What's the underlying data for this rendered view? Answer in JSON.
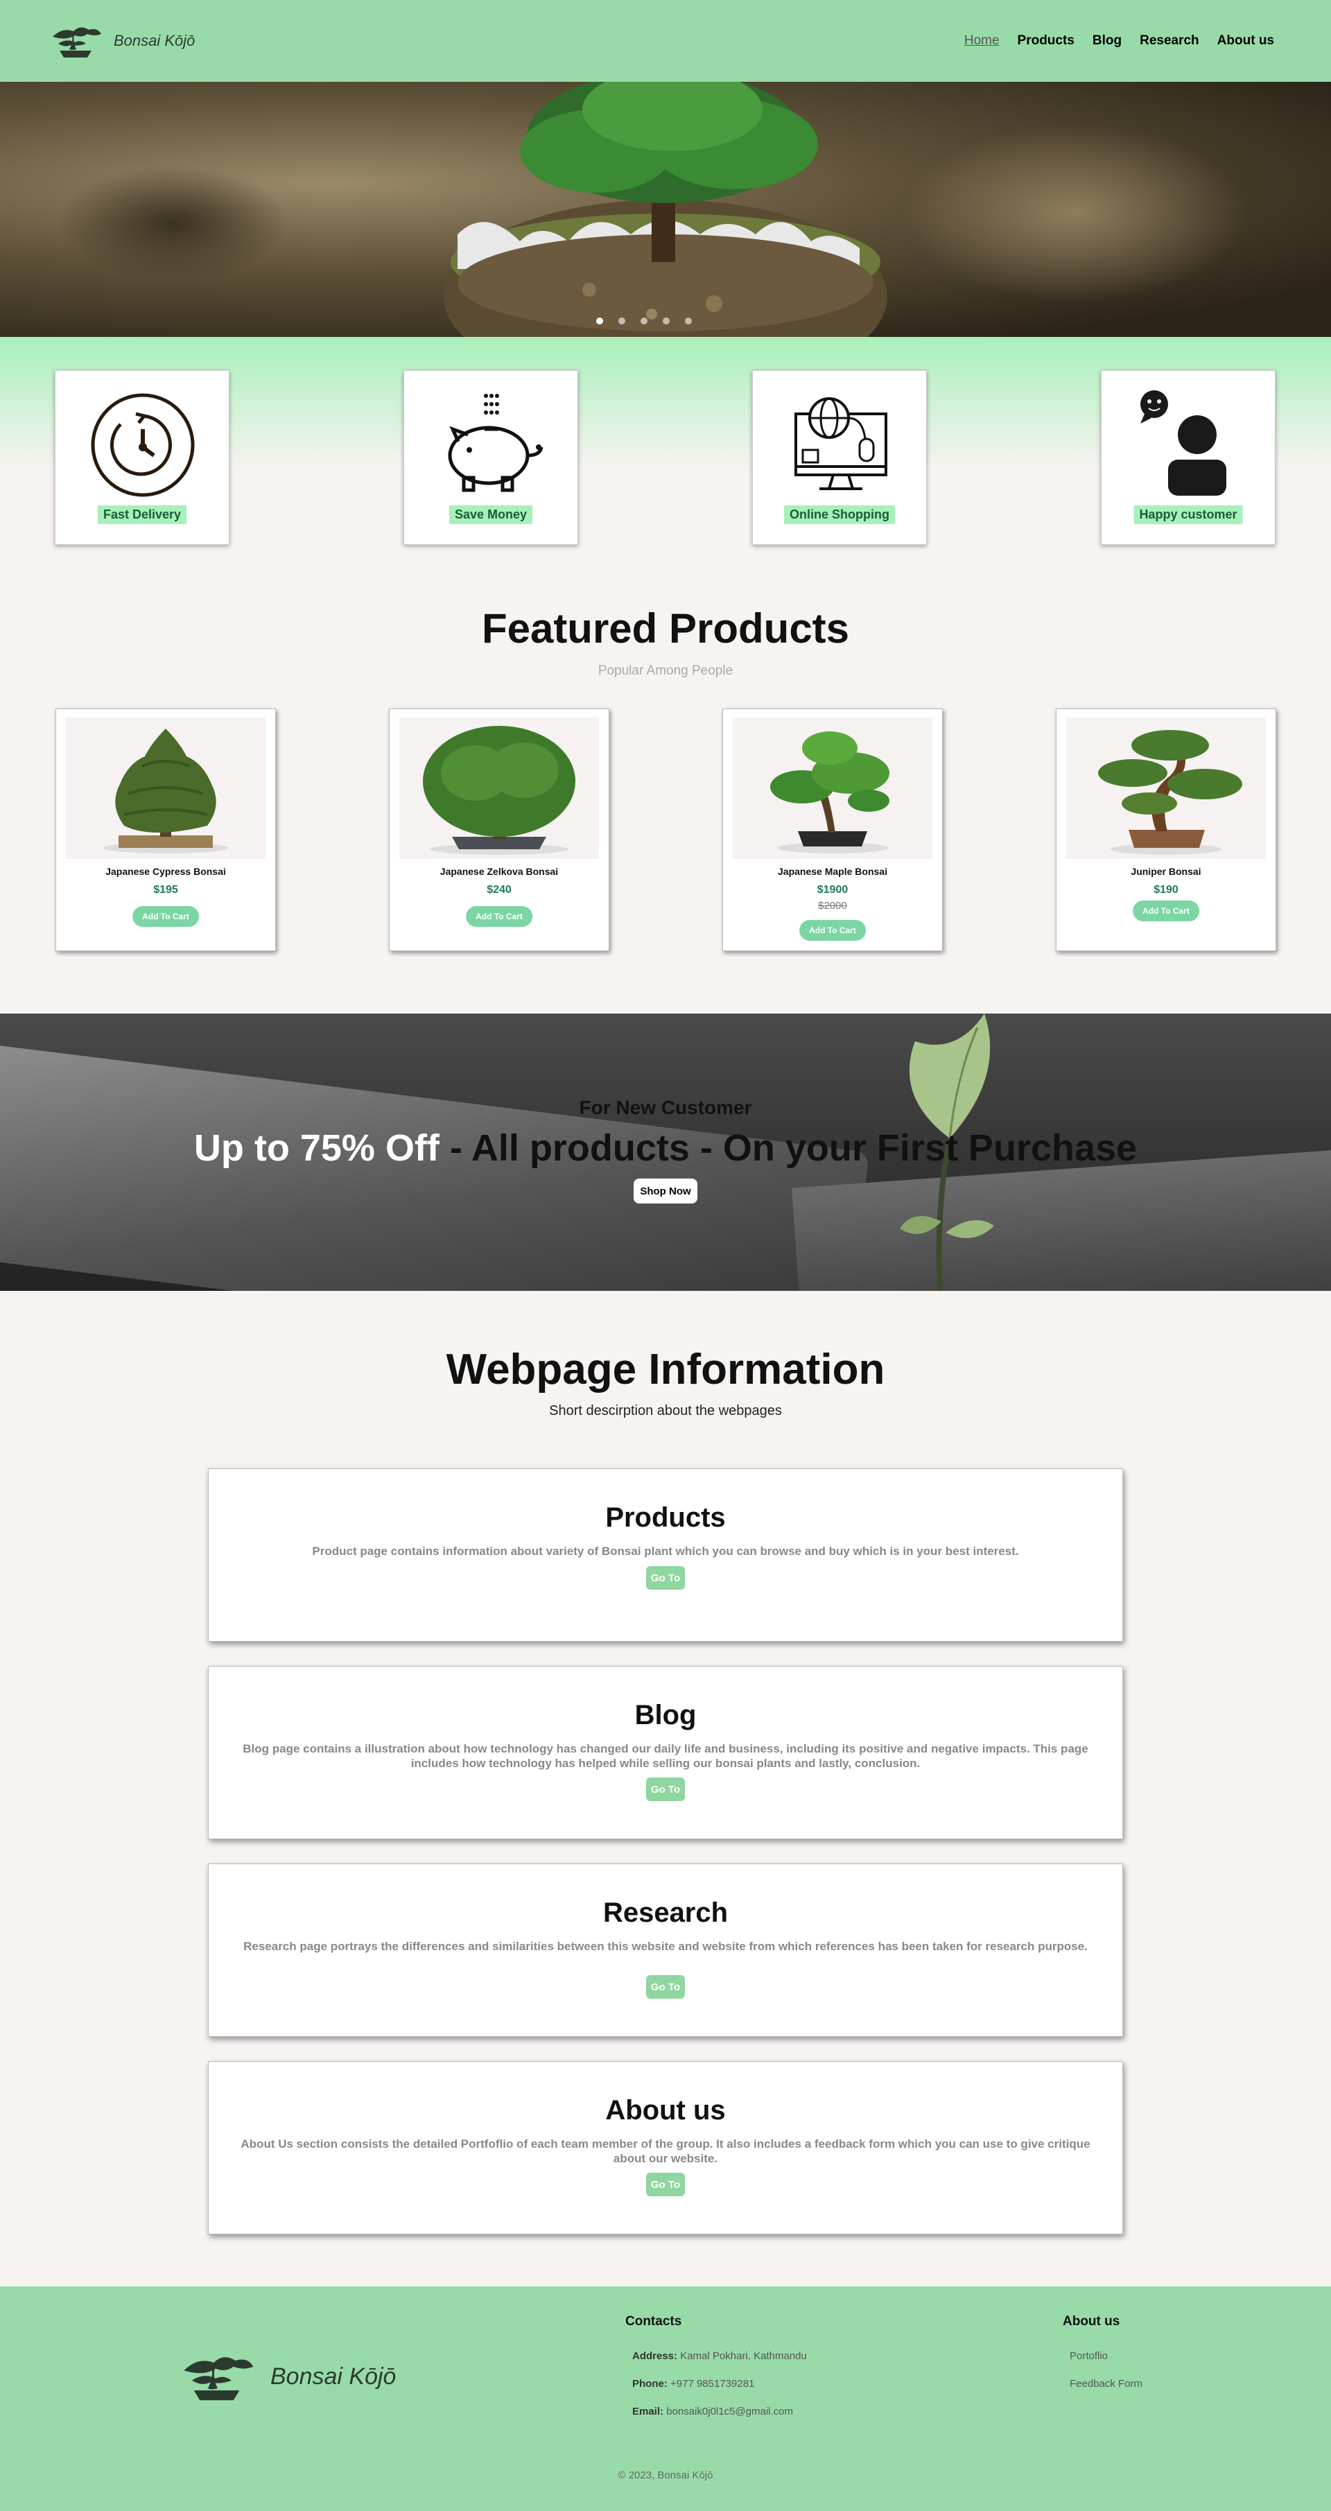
{
  "header": {
    "brand": "Bonsai Kōjō",
    "nav": [
      {
        "label": "Home",
        "active": true
      },
      {
        "label": "Products",
        "active": false
      },
      {
        "label": "Blog",
        "active": false
      },
      {
        "label": "Research",
        "active": false
      },
      {
        "label": "About us",
        "active": false
      }
    ]
  },
  "hero": {
    "slides_count": 5,
    "active_slide": 0
  },
  "features": [
    {
      "label": "Fast Delivery",
      "icon": "clock-icon"
    },
    {
      "label": "Save Money",
      "icon": "piggy-bank-icon"
    },
    {
      "label": "Online Shopping",
      "icon": "computer-globe-icon"
    },
    {
      "label": "Happy customer",
      "icon": "customer-icon"
    }
  ],
  "featured": {
    "title": "Featured Products",
    "subtitle": "Popular Among People",
    "products": [
      {
        "name": "Japanese Cypress Bonsai",
        "price": "$195",
        "old_price": "",
        "button": "Add To Cart"
      },
      {
        "name": "Japanese Zelkova Bonsai",
        "price": "$240",
        "old_price": "",
        "button": "Add To Cart"
      },
      {
        "name": "Japanese Maple Bonsai",
        "price": "$1900",
        "old_price": "$2000",
        "button": "Add To Cart"
      },
      {
        "name": "Juniper Bonsai",
        "price": "$190",
        "old_price": "",
        "button": "Add To Cart"
      }
    ]
  },
  "promo": {
    "pre": "For New Customer",
    "highlight": "Up to 75% Off",
    "rest": " - All products - On your First Purchase",
    "button": "Shop Now"
  },
  "info": {
    "title": "Webpage Information",
    "subtitle": "Short descirption about the webpages",
    "cards": [
      {
        "title": "Products",
        "text": "Product page contains information about variety of Bonsai plant which you can browse and buy which is in your best interest.",
        "button": "Go To"
      },
      {
        "title": "Blog",
        "text": "Blog page contains a illustration about how technology has changed our daily life and business, including its positive and negative impacts. This page includes how technology has helped while selling our bonsai plants and lastly, conclusion.",
        "button": "Go To"
      },
      {
        "title": "Research",
        "text": "Research page portrays the differences and similarities between this website and website from which references has been taken for research purpose.",
        "button": "Go To"
      },
      {
        "title": "About us",
        "text": "About Us section consists the detailed Portfoflio of each team member of the group. It also includes a feedback form which you can use to give critique about our website.",
        "button": "Go To"
      }
    ]
  },
  "footer": {
    "brand": "Bonsai Kōjō",
    "contacts": {
      "heading": "Contacts",
      "address_label": "Address:",
      "address": "Kamal Pokhari, Kathmandu",
      "phone_label": "Phone:",
      "phone": "+977 9851739281",
      "email_label": "Email:",
      "email": "bonsaik0j0l1c5@gmail.com"
    },
    "about": {
      "heading": "About us",
      "links": [
        "Portoflio",
        "Feedback Form"
      ]
    },
    "copyright": "© 2023, Bonsai Kōjō"
  },
  "colors": {
    "header_bg": "#98dba9",
    "accent": "#a8f0b9",
    "price": "#1d7a5b",
    "button": "#8fd6a0"
  }
}
